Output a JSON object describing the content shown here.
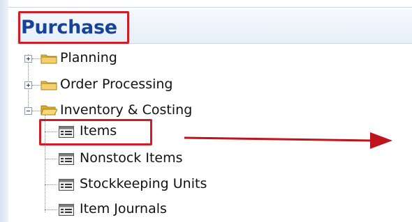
{
  "sidebar": {
    "title": "Purchase",
    "items": [
      {
        "label": "Planning",
        "icon": "folder-icon",
        "expander": "plus"
      },
      {
        "label": "Order Processing",
        "icon": "folder-icon",
        "expander": "plus"
      },
      {
        "label": "Inventory & Costing",
        "icon": "folder-open-icon",
        "expander": "minus",
        "children": [
          {
            "label": "Items",
            "icon": "list-page-icon"
          },
          {
            "label": "Nonstock Items",
            "icon": "list-page-icon"
          },
          {
            "label": "Stockkeeping Units",
            "icon": "list-page-icon"
          },
          {
            "label": "Item Journals",
            "icon": "list-page-icon"
          }
        ]
      }
    ]
  },
  "annotations": {
    "highlight_color": "#d01c24",
    "arrow_color": "#c0141c"
  },
  "colors": {
    "title": "#15429b",
    "header_bg": "#e6eef8"
  }
}
